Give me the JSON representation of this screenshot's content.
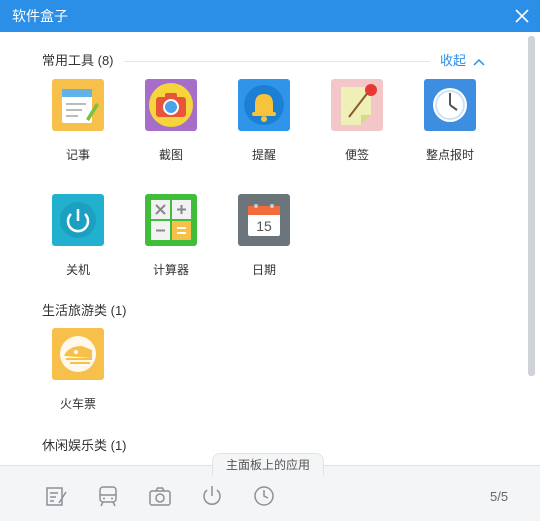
{
  "window": {
    "title": "软件盒子"
  },
  "sections": [
    {
      "title": "常用工具 (8)",
      "collapse_label": "收起"
    },
    {
      "title": "生活旅游类 (1)"
    },
    {
      "title": "休闲娱乐类 (1)"
    }
  ],
  "apps": [
    {
      "label": "记事",
      "icon": "notepad-icon",
      "color": "#f7c04a"
    },
    {
      "label": "截图",
      "icon": "camera-icon",
      "color": "#a66ec9"
    },
    {
      "label": "提醒",
      "icon": "bell-icon",
      "color": "#2f95e8"
    },
    {
      "label": "便签",
      "icon": "sticky-note-icon",
      "color": "#f3c7c7"
    },
    {
      "label": "整点报时",
      "icon": "clock-icon",
      "color": "#3d8ee0"
    },
    {
      "label": "关机",
      "icon": "power-icon",
      "color": "#22b0cf"
    },
    {
      "label": "计算器",
      "icon": "calculator-icon",
      "color": "#3fbd3b"
    },
    {
      "label": "日期",
      "icon": "calendar-icon",
      "color": "#6b737b",
      "calendar_day": "15"
    },
    {
      "label": "火车票",
      "icon": "train-icon",
      "color": "#f7c04a"
    }
  ],
  "footer": {
    "tab_label": "主面板上的应用",
    "dock_icons": [
      "notepad-icon",
      "train-icon",
      "camera-icon",
      "power-icon",
      "clock-icon"
    ],
    "pager": "5/5"
  },
  "colors": {
    "accent": "#2b8fe8",
    "titlebar": "#2b8fe8"
  }
}
